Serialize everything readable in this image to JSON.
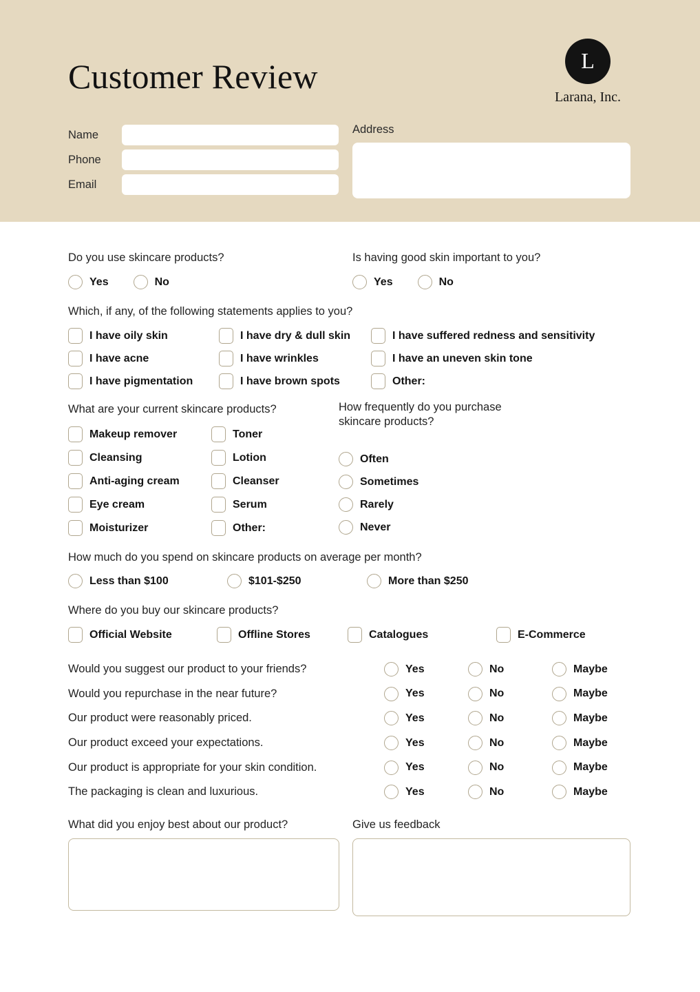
{
  "header": {
    "title": "Customer Review",
    "brand": {
      "mark_letter": "L",
      "name": "Larana, Inc."
    },
    "background_color": "#e5d9c0",
    "contact": {
      "name_label": "Name",
      "phone_label": "Phone",
      "email_label": "Email",
      "address_label": "Address",
      "name_value": "",
      "phone_value": "",
      "email_value": "",
      "address_value": ""
    }
  },
  "questions": {
    "use_skincare": {
      "label": "Do you use skincare products?",
      "options": [
        "Yes",
        "No"
      ]
    },
    "good_skin_important": {
      "label": "Is having good skin important to you?",
      "options": [
        "Yes",
        "No"
      ]
    },
    "statements": {
      "label": "Which, if any, of the following statements applies to you?",
      "options": [
        "I have oily skin",
        "I have dry & dull skin",
        "I have suffered redness and sensitivity",
        "I have acne",
        "I have wrinkles",
        "I have an uneven skin tone",
        "I have pigmentation",
        "I have brown spots",
        "Other:"
      ]
    },
    "current_products": {
      "label": "What are your current skincare products?",
      "options": [
        "Makeup remover",
        "Toner",
        "Cleansing",
        "Lotion",
        "Anti-aging cream",
        "Cleanser",
        "Eye cream",
        "Serum",
        "Moisturizer",
        "Other:"
      ]
    },
    "purchase_frequency": {
      "label": "How frequently do you purchase skincare products?",
      "options": [
        "Often",
        "Sometimes",
        "Rarely",
        "Never"
      ]
    },
    "monthly_spend": {
      "label": "How much do you spend on skincare products on average per month?",
      "options": [
        "Less than $100",
        "$101-$250",
        "More than $250"
      ]
    },
    "where_buy": {
      "label": "Where do you buy our skincare products?",
      "options": [
        "Official Website",
        "Offline Stores",
        "Catalogues",
        "E-Commerce"
      ]
    },
    "matrix": {
      "choices": [
        "Yes",
        "No",
        "Maybe"
      ],
      "rows": [
        "Would you suggest our product to your friends?",
        "Would you repurchase in the near future?",
        "Our product were reasonably priced.",
        "Our product exceed your expectations.",
        "Our product is appropriate for your skin condition.",
        "The packaging is clean and luxurious."
      ]
    },
    "enjoy_best": {
      "label": "What did you enjoy best about our product?",
      "value": ""
    },
    "feedback": {
      "label": "Give us feedback",
      "value": ""
    }
  }
}
